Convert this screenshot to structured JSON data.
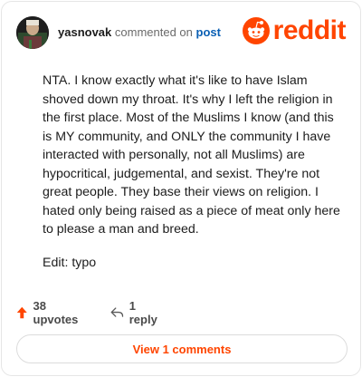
{
  "comment": {
    "username": "yasnovak",
    "action_text": "commented on",
    "post_link": "post",
    "paragraphs": [
      "NTA. I know exactly what it's like to have Islam shoved down my throat. It's why I left the religion in the first place. Most of the Muslims I know (and this is MY community, and ONLY the community I have interacted with personally, not all Muslims) are hypocritical, judgemental, and sexist. They're not great people. They base their views on religion. I hated only being raised as a piece of meat only here to please a man and breed.",
      "Edit: typo"
    ]
  },
  "brand": {
    "name": "reddit",
    "icon": "reddit-snoo-icon",
    "color": "#ff4500"
  },
  "actions": {
    "upvotes": "38 upvotes",
    "replies": "1 reply"
  },
  "view_comments_label": "View 1 comments"
}
